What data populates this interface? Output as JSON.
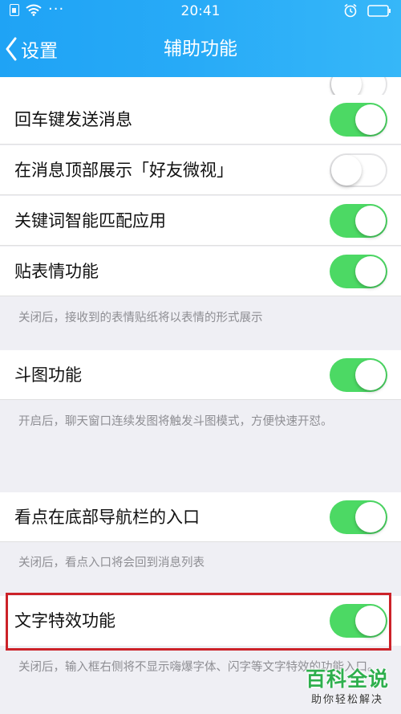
{
  "status_bar": {
    "time": "20:41",
    "left_extra": "···",
    "icons": [
      "sim-icon",
      "wifi-icon",
      "alarm-icon",
      "battery-icon"
    ]
  },
  "nav": {
    "back_label": "设置",
    "title": "辅助功能"
  },
  "colors": {
    "header_blue": "#27aaf7",
    "toggle_on": "#4cd964",
    "highlight_red": "#cc2229",
    "background": "#efeff4"
  },
  "settings": [
    {
      "label": "回车键发送消息",
      "enabled": true
    },
    {
      "label": "在消息顶部展示「好友微视」",
      "enabled": false
    },
    {
      "label": "关键词智能匹配应用",
      "enabled": true
    },
    {
      "label": "贴表情功能",
      "enabled": true
    },
    {
      "label": "斗图功能",
      "enabled": true
    },
    {
      "label": "看点在底部导航栏的入口",
      "enabled": true
    },
    {
      "label": "文字特效功能",
      "enabled": true
    }
  ],
  "footnotes": {
    "sticker": "关闭后，接收到的表情贴纸将以表情的形式展示",
    "doutu": "开启后，聊天窗口连续发图将触发斗图模式，方便快速开怼。",
    "kandian": "关闭后，看点入口将会回到消息列表",
    "text_effect": "关闭后，输入框右侧将不显示嗨爆字体、闪字等文字特效的功能入口。"
  },
  "watermark": {
    "main": "百科全说",
    "sub": "助你轻松解决"
  }
}
